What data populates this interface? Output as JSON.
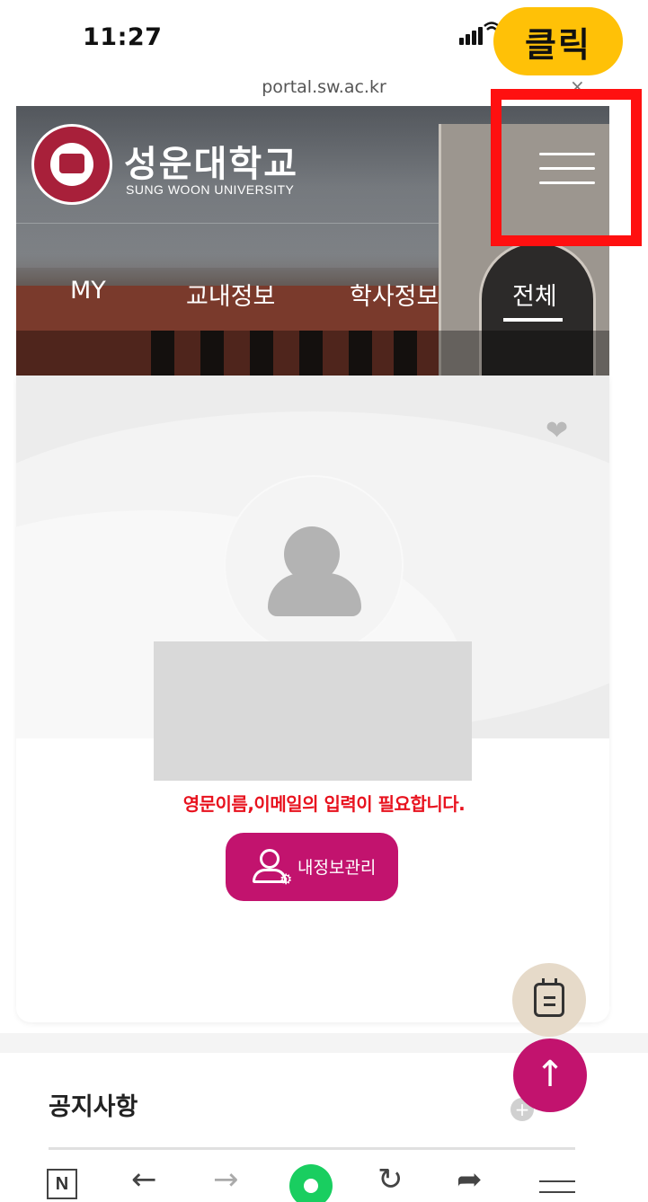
{
  "status_bar": {
    "time": "11:27"
  },
  "annotation": {
    "badge_text": "클릭"
  },
  "browser": {
    "url": "portal.sw.ac.kr",
    "close_glyph": "×"
  },
  "header": {
    "university_name": "성운대학교",
    "university_name_en": "SUNG WOON UNIVERSITY",
    "tabs": [
      {
        "label": "MY",
        "active": false
      },
      {
        "label": "교내정보",
        "active": false
      },
      {
        "label": "학사정보",
        "active": false
      },
      {
        "label": "전체",
        "active": true
      }
    ],
    "menu_icon": "hamburger-menu-icon"
  },
  "profile": {
    "warning_text": "영문이름,이메일의 입력이 필요합니다.",
    "manage_button_label": "내정보관리",
    "favorite_icon": "heart-icon",
    "avatar_icon": "user-avatar-icon"
  },
  "notice": {
    "title": "공지사항",
    "more_icon": "plus-icon"
  },
  "fabs": {
    "calendar_icon": "calendar-icon",
    "scroll_top_icon": "arrow-up-icon"
  },
  "bottom_bar": {
    "icons": [
      "naver-n-icon",
      "back-icon",
      "forward-icon",
      "green-dot-icon",
      "refresh-icon",
      "share-icon",
      "menu-icon"
    ]
  },
  "colors": {
    "accent": "#c2136e",
    "warning": "#e8121e",
    "badge": "#ffc107",
    "highlight_box": "#ff1010",
    "green": "#19ce60"
  }
}
